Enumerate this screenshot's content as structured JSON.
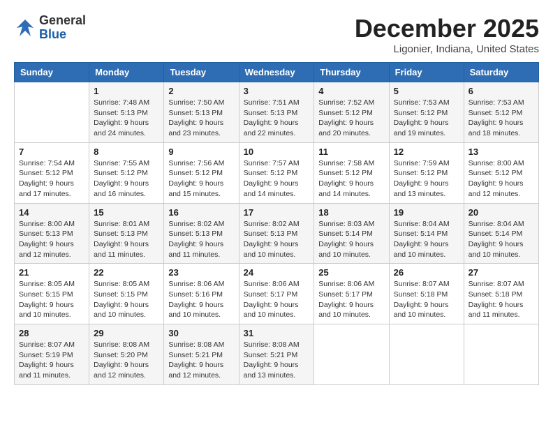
{
  "header": {
    "logo_general": "General",
    "logo_blue": "Blue",
    "month_title": "December 2025",
    "location": "Ligonier, Indiana, United States"
  },
  "weekdays": [
    "Sunday",
    "Monday",
    "Tuesday",
    "Wednesday",
    "Thursday",
    "Friday",
    "Saturday"
  ],
  "weeks": [
    [
      {
        "day": "",
        "info": ""
      },
      {
        "day": "1",
        "info": "Sunrise: 7:48 AM\nSunset: 5:13 PM\nDaylight: 9 hours\nand 24 minutes."
      },
      {
        "day": "2",
        "info": "Sunrise: 7:50 AM\nSunset: 5:13 PM\nDaylight: 9 hours\nand 23 minutes."
      },
      {
        "day": "3",
        "info": "Sunrise: 7:51 AM\nSunset: 5:13 PM\nDaylight: 9 hours\nand 22 minutes."
      },
      {
        "day": "4",
        "info": "Sunrise: 7:52 AM\nSunset: 5:12 PM\nDaylight: 9 hours\nand 20 minutes."
      },
      {
        "day": "5",
        "info": "Sunrise: 7:53 AM\nSunset: 5:12 PM\nDaylight: 9 hours\nand 19 minutes."
      },
      {
        "day": "6",
        "info": "Sunrise: 7:53 AM\nSunset: 5:12 PM\nDaylight: 9 hours\nand 18 minutes."
      }
    ],
    [
      {
        "day": "7",
        "info": "Sunrise: 7:54 AM\nSunset: 5:12 PM\nDaylight: 9 hours\nand 17 minutes."
      },
      {
        "day": "8",
        "info": "Sunrise: 7:55 AM\nSunset: 5:12 PM\nDaylight: 9 hours\nand 16 minutes."
      },
      {
        "day": "9",
        "info": "Sunrise: 7:56 AM\nSunset: 5:12 PM\nDaylight: 9 hours\nand 15 minutes."
      },
      {
        "day": "10",
        "info": "Sunrise: 7:57 AM\nSunset: 5:12 PM\nDaylight: 9 hours\nand 14 minutes."
      },
      {
        "day": "11",
        "info": "Sunrise: 7:58 AM\nSunset: 5:12 PM\nDaylight: 9 hours\nand 14 minutes."
      },
      {
        "day": "12",
        "info": "Sunrise: 7:59 AM\nSunset: 5:12 PM\nDaylight: 9 hours\nand 13 minutes."
      },
      {
        "day": "13",
        "info": "Sunrise: 8:00 AM\nSunset: 5:12 PM\nDaylight: 9 hours\nand 12 minutes."
      }
    ],
    [
      {
        "day": "14",
        "info": "Sunrise: 8:00 AM\nSunset: 5:13 PM\nDaylight: 9 hours\nand 12 minutes."
      },
      {
        "day": "15",
        "info": "Sunrise: 8:01 AM\nSunset: 5:13 PM\nDaylight: 9 hours\nand 11 minutes."
      },
      {
        "day": "16",
        "info": "Sunrise: 8:02 AM\nSunset: 5:13 PM\nDaylight: 9 hours\nand 11 minutes."
      },
      {
        "day": "17",
        "info": "Sunrise: 8:02 AM\nSunset: 5:13 PM\nDaylight: 9 hours\nand 10 minutes."
      },
      {
        "day": "18",
        "info": "Sunrise: 8:03 AM\nSunset: 5:14 PM\nDaylight: 9 hours\nand 10 minutes."
      },
      {
        "day": "19",
        "info": "Sunrise: 8:04 AM\nSunset: 5:14 PM\nDaylight: 9 hours\nand 10 minutes."
      },
      {
        "day": "20",
        "info": "Sunrise: 8:04 AM\nSunset: 5:14 PM\nDaylight: 9 hours\nand 10 minutes."
      }
    ],
    [
      {
        "day": "21",
        "info": "Sunrise: 8:05 AM\nSunset: 5:15 PM\nDaylight: 9 hours\nand 10 minutes."
      },
      {
        "day": "22",
        "info": "Sunrise: 8:05 AM\nSunset: 5:15 PM\nDaylight: 9 hours\nand 10 minutes."
      },
      {
        "day": "23",
        "info": "Sunrise: 8:06 AM\nSunset: 5:16 PM\nDaylight: 9 hours\nand 10 minutes."
      },
      {
        "day": "24",
        "info": "Sunrise: 8:06 AM\nSunset: 5:17 PM\nDaylight: 9 hours\nand 10 minutes."
      },
      {
        "day": "25",
        "info": "Sunrise: 8:06 AM\nSunset: 5:17 PM\nDaylight: 9 hours\nand 10 minutes."
      },
      {
        "day": "26",
        "info": "Sunrise: 8:07 AM\nSunset: 5:18 PM\nDaylight: 9 hours\nand 10 minutes."
      },
      {
        "day": "27",
        "info": "Sunrise: 8:07 AM\nSunset: 5:18 PM\nDaylight: 9 hours\nand 11 minutes."
      }
    ],
    [
      {
        "day": "28",
        "info": "Sunrise: 8:07 AM\nSunset: 5:19 PM\nDaylight: 9 hours\nand 11 minutes."
      },
      {
        "day": "29",
        "info": "Sunrise: 8:08 AM\nSunset: 5:20 PM\nDaylight: 9 hours\nand 12 minutes."
      },
      {
        "day": "30",
        "info": "Sunrise: 8:08 AM\nSunset: 5:21 PM\nDaylight: 9 hours\nand 12 minutes."
      },
      {
        "day": "31",
        "info": "Sunrise: 8:08 AM\nSunset: 5:21 PM\nDaylight: 9 hours\nand 13 minutes."
      },
      {
        "day": "",
        "info": ""
      },
      {
        "day": "",
        "info": ""
      },
      {
        "day": "",
        "info": ""
      }
    ]
  ]
}
